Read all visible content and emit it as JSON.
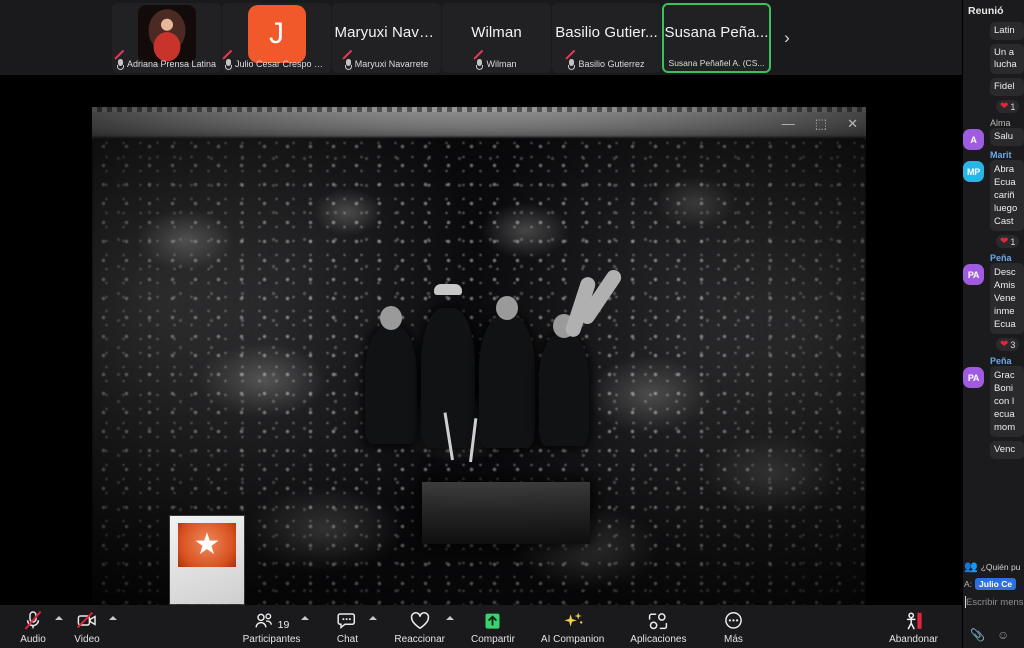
{
  "filmstrip": {
    "participants": [
      {
        "display": "",
        "footer": "Adriana Prensa Latina",
        "avatar_type": "photo",
        "avatar_color": "#3a1d1a",
        "initial": "",
        "muted": true,
        "active": false
      },
      {
        "display": "",
        "footer": "Julio Cesar Crespo Di...",
        "avatar_type": "letter",
        "avatar_color": "#f2592a",
        "initial": "J",
        "muted": true,
        "active": false
      },
      {
        "display": "Maryuxi Nava...",
        "footer": "Maryuxi Navarrete",
        "avatar_type": "none",
        "avatar_color": "",
        "initial": "",
        "muted": true,
        "active": false
      },
      {
        "display": "Wilman",
        "footer": "Wilman",
        "avatar_type": "none",
        "avatar_color": "",
        "initial": "",
        "muted": true,
        "active": false
      },
      {
        "display": "Basilio Gutier...",
        "footer": "Basilio Gutierrez",
        "avatar_type": "none",
        "avatar_color": "",
        "initial": "",
        "muted": true,
        "active": false
      },
      {
        "display": "Susana Peña...",
        "footer": "Susana Peñafiel A. (CS...",
        "avatar_type": "none",
        "avatar_color": "",
        "initial": "",
        "muted": false,
        "active": true
      }
    ],
    "next_arrow": "›",
    "active_border_color": "#3ac15c"
  },
  "share_window": {
    "minimize_label": "—",
    "maximize_label": "⬚",
    "close_label": "✕",
    "watermark_star": "★"
  },
  "toolbar": {
    "audio": {
      "label": "Audio",
      "muted": true
    },
    "video": {
      "label": "Video",
      "off": true
    },
    "participants": {
      "label": "Participantes",
      "count": "19"
    },
    "chat": {
      "label": "Chat"
    },
    "react": {
      "label": "Reaccionar"
    },
    "share": {
      "label": "Compartir",
      "color": "#3ad16f"
    },
    "ai": {
      "label": "AI Companion",
      "color": "#f2d14e"
    },
    "apps": {
      "label": "Aplicaciones"
    },
    "more": {
      "label": "Más"
    },
    "leave": {
      "label": "Abandonar",
      "color": "#e0253c"
    }
  },
  "chat_panel": {
    "header": "Reunió",
    "messages": [
      {
        "author": "",
        "author_style": "none",
        "avatar": "",
        "avatar_color": "",
        "lines": [
          "Latin"
        ],
        "reaction": null
      },
      {
        "author": "",
        "author_style": "none",
        "avatar": "",
        "avatar_color": "",
        "lines": [
          "Un a",
          "lucha"
        ],
        "reaction": null
      },
      {
        "author": "",
        "author_style": "none",
        "avatar": "",
        "avatar_color": "",
        "lines": [
          "Fidel"
        ],
        "reaction": {
          "emoji": "❤",
          "count": "1"
        }
      },
      {
        "author": "Alma",
        "author_style": "plain",
        "avatar": "A",
        "avatar_color": "#a05ce0",
        "lines": [
          "Salu"
        ],
        "reaction": null
      },
      {
        "author": "Marit",
        "author_style": "link",
        "avatar": "MP",
        "avatar_color": "#28b6e8",
        "lines": [
          "Abra",
          "Ecua",
          "cariñ",
          "luego",
          "Cast"
        ],
        "reaction": {
          "emoji": "❤",
          "count": "1"
        }
      },
      {
        "author": "Peña",
        "author_style": "link",
        "avatar": "PA",
        "avatar_color": "#a05ce0",
        "lines": [
          "Desc",
          "Amis",
          "Vene",
          "inme",
          "Ecua"
        ],
        "reaction": {
          "emoji": "❤",
          "count": "3"
        }
      },
      {
        "author": "Peña",
        "author_style": "link",
        "avatar": "PA",
        "avatar_color": "#a05ce0",
        "lines": [
          "Grac",
          "Boni",
          "con l",
          "ecua",
          "mom"
        ],
        "reaction": null
      },
      {
        "author": "",
        "author_style": "none",
        "avatar": "",
        "avatar_color": "",
        "lines": [
          "Venc"
        ],
        "reaction": null
      }
    ],
    "who_can_see": "¿Quién pu",
    "to_label": "A:",
    "to_chip": "Julio Ce",
    "compose_placeholder": "Escribir mens"
  }
}
